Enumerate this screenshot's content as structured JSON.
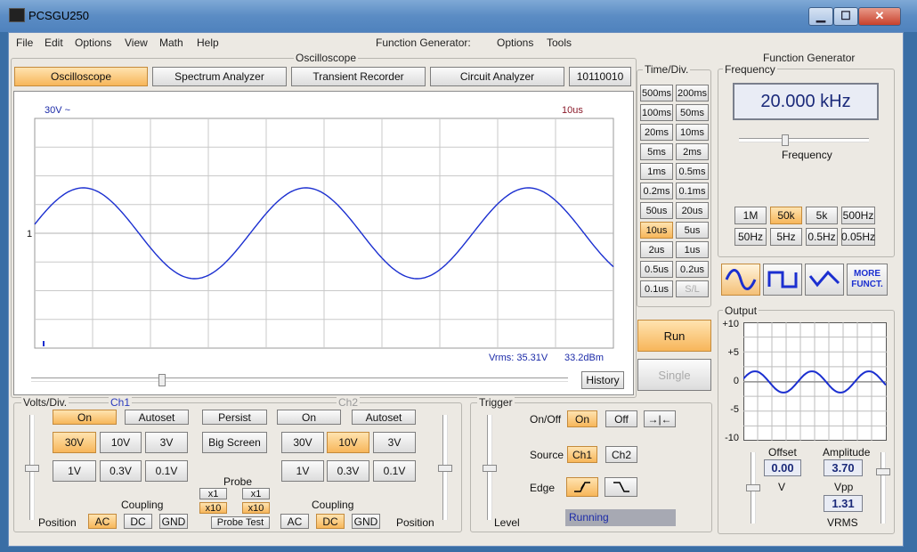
{
  "window": {
    "title": "PCSGU250",
    "minimize": "▁",
    "maximize": "☐",
    "close": "✕"
  },
  "menu": {
    "left": [
      "File",
      "Edit",
      "Options",
      "View",
      "Math",
      "Help"
    ],
    "fg_label": "Function Generator:",
    "fg_items": [
      "Options",
      "Tools"
    ]
  },
  "oscilloscope": {
    "group_title": "Oscilloscope",
    "tabs": [
      "Oscilloscope",
      "Spectrum Analyzer",
      "Transient Recorder",
      "Circuit Analyzer"
    ],
    "code": "10110010",
    "scale_label": "30V ~",
    "time_label": "10us",
    "ch_marker": "1",
    "vrms": "Vrms: 35.31V",
    "dbm": "33.2dBm",
    "history": "History"
  },
  "time_div": {
    "title": "Time/Div.",
    "buttons": [
      "500ms",
      "200ms",
      "100ms",
      "50ms",
      "20ms",
      "10ms",
      "5ms",
      "2ms",
      "1ms",
      "0.5ms",
      "0.2ms",
      "0.1ms",
      "50us",
      "20us",
      "10us",
      "5us",
      "2us",
      "1us",
      "0.5us",
      "0.2us",
      "0.1us",
      "S/L"
    ],
    "selected": "10us",
    "run": "Run",
    "single": "Single"
  },
  "volts": {
    "title": "Volts/Div.",
    "ch1": "Ch1",
    "ch2": "Ch2",
    "on": "On",
    "autoset": "Autoset",
    "persist": "Persist",
    "big_screen": "Big Screen",
    "row1": [
      "30V",
      "10V",
      "3V"
    ],
    "row2": [
      "1V",
      "0.3V",
      "0.1V"
    ],
    "ch1_selected": "30V",
    "ch2_selected": "10V",
    "probe": "Probe",
    "x1": "x1",
    "x10": "x10",
    "probe_test": "Probe Test",
    "coupling": "Coupling",
    "ac": "AC",
    "dc": "DC",
    "gnd": "GND",
    "position": "Position"
  },
  "trigger": {
    "title": "Trigger",
    "onoff": "On/Off",
    "on": "On",
    "off": "Off",
    "source": "Source",
    "ch1": "Ch1",
    "ch2": "Ch2",
    "edge": "Edge",
    "level": "Level",
    "status": "Running"
  },
  "fg": {
    "title": "Function Generator",
    "freq_group": "Frequency",
    "freq_value": "20.000 kHz",
    "freq_slider_label": "Frequency",
    "range_row1": [
      "1M",
      "50k",
      "5k",
      "500Hz"
    ],
    "range_row2": [
      "50Hz",
      "5Hz",
      "0.5Hz",
      "0.05Hz"
    ],
    "range_selected": "50k",
    "more": "MORE FUNCT.",
    "output": "Output",
    "yticks": [
      "+10",
      "+5",
      "0",
      "-5",
      "-10"
    ],
    "offset_label": "Offset",
    "offset_value": "0.00",
    "offset_unit": "V",
    "amp_label": "Amplitude",
    "amp_value": "3.70",
    "amp_unit": "Vpp",
    "rms_value": "1.31",
    "rms_unit": "VRMS"
  },
  "colors": {
    "trace": "#1b2fd0",
    "selected": "#f7b65a",
    "grid": "#c9c9c9"
  }
}
